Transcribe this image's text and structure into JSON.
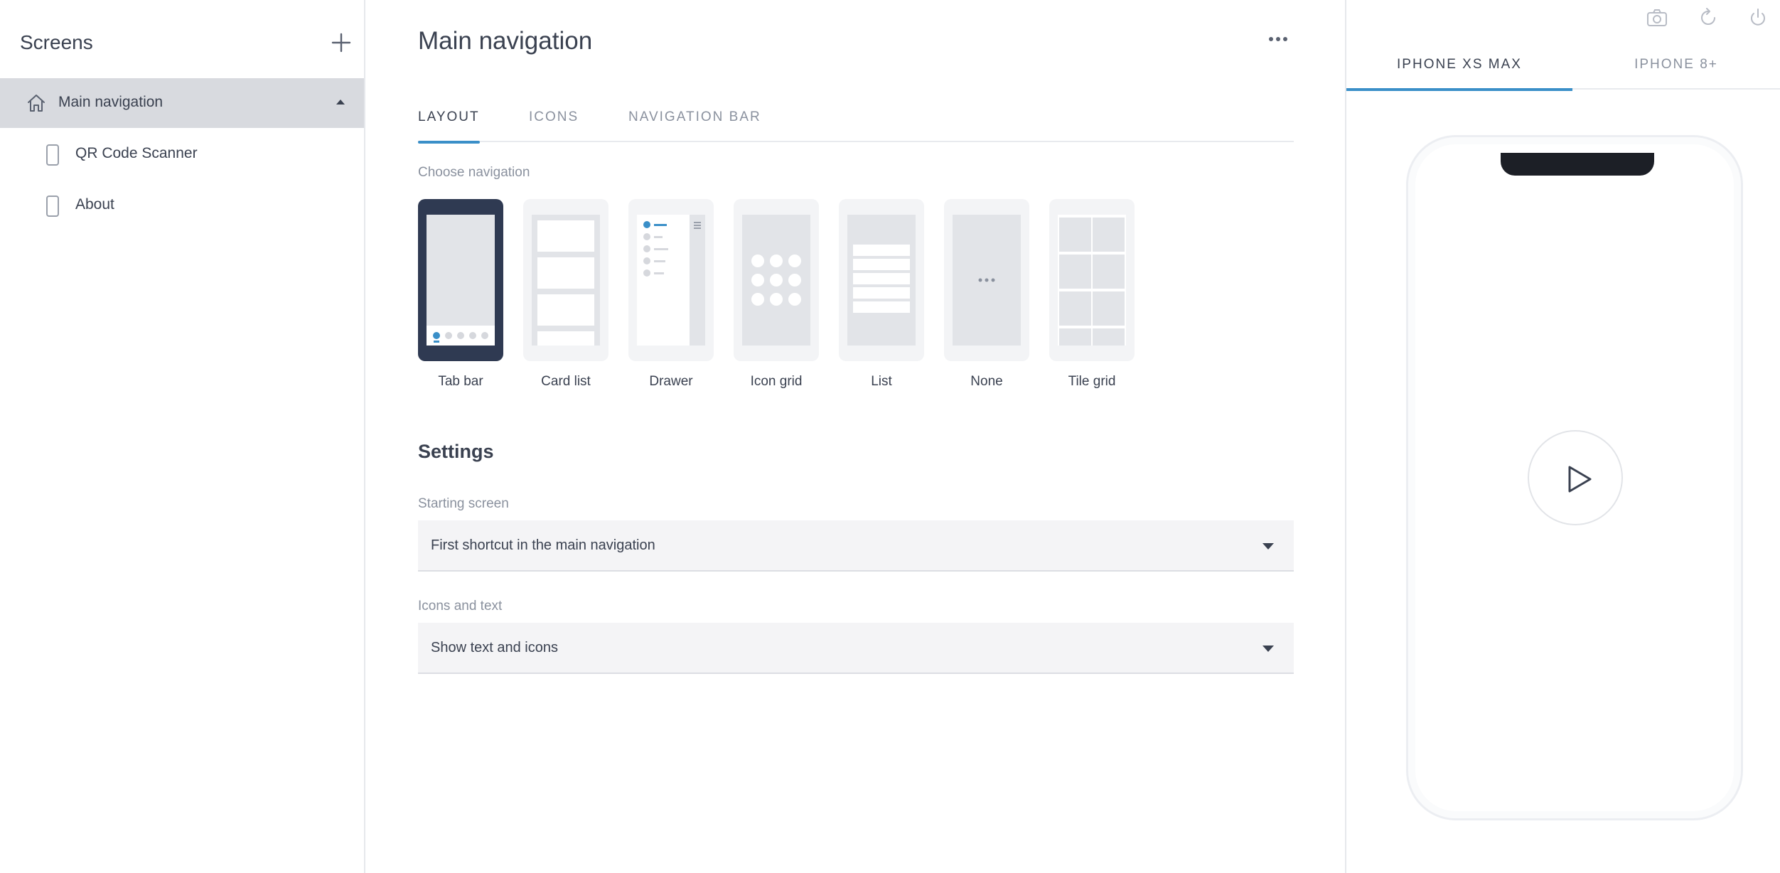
{
  "sidebar": {
    "title": "Screens",
    "items": [
      {
        "label": "Main navigation",
        "icon": "home-icon",
        "active": true
      },
      {
        "label": "QR Code Scanner",
        "icon": "phone-screen-icon"
      },
      {
        "label": "About",
        "icon": "phone-screen-icon"
      }
    ]
  },
  "main": {
    "title": "Main navigation",
    "tabs": [
      {
        "label": "LAYOUT",
        "active": true
      },
      {
        "label": "ICONS"
      },
      {
        "label": "NAVIGATION BAR"
      }
    ],
    "choose_navigation_label": "Choose navigation",
    "layouts": [
      {
        "label": "Tab bar",
        "selected": true
      },
      {
        "label": "Card list"
      },
      {
        "label": "Drawer"
      },
      {
        "label": "Icon grid"
      },
      {
        "label": "List"
      },
      {
        "label": "None"
      },
      {
        "label": "Tile grid"
      }
    ],
    "settings": {
      "title": "Settings",
      "starting_screen": {
        "label": "Starting screen",
        "value": "First shortcut in the main navigation"
      },
      "icons_and_text": {
        "label": "Icons and text",
        "value": "Show text and icons"
      }
    }
  },
  "preview": {
    "tabs": [
      {
        "label": "IPHONE XS MAX",
        "active": true
      },
      {
        "label": "IPHONE 8+"
      }
    ],
    "top_icons": [
      "camera-icon",
      "refresh-icon",
      "power-icon"
    ]
  },
  "colors": {
    "accent": "#3a8fc8",
    "selected_card": "#2f3a52",
    "active_row": "#d8dadf",
    "text": "#3a4150",
    "muted": "#8a919e"
  }
}
